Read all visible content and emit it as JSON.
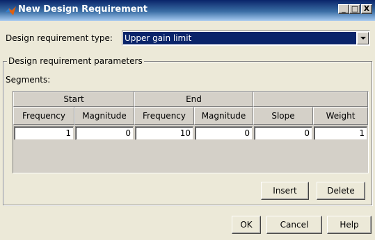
{
  "window": {
    "title": "New Design Requirement",
    "minimize": "_",
    "maximize": "□",
    "close": "X"
  },
  "requirement": {
    "type_label": "Design requirement type:",
    "type_value": "Upper gain limit"
  },
  "parameters": {
    "group_title": "Design requirement parameters",
    "segments_label": "Segments:"
  },
  "table": {
    "group_headers": [
      "Start",
      "End",
      ""
    ],
    "columns": [
      "Frequency",
      "Magnitude",
      "Frequency",
      "Magnitude",
      "Slope",
      "Weight"
    ],
    "rows": [
      [
        "1",
        "0",
        "10",
        "0",
        "0",
        "1"
      ]
    ]
  },
  "buttons": {
    "insert": "Insert",
    "delete": "Delete",
    "ok": "OK",
    "cancel": "Cancel",
    "help": "Help"
  }
}
